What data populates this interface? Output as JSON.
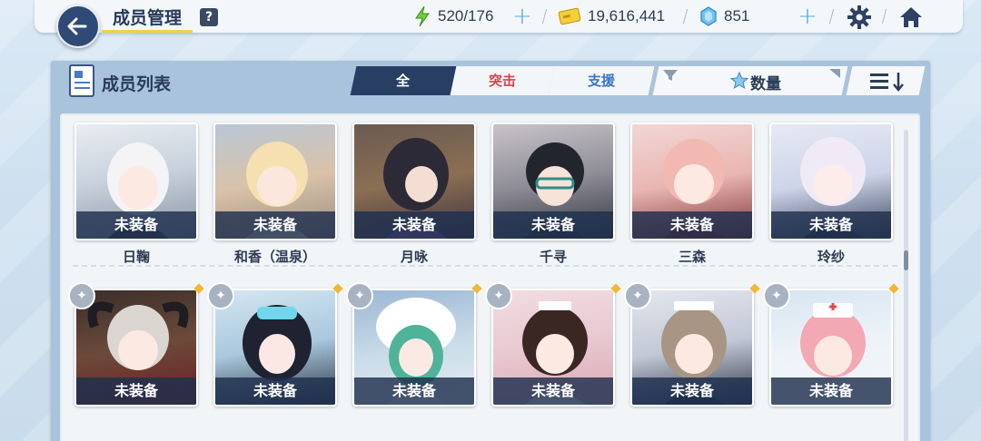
{
  "header": {
    "title": "成员管理",
    "help": "?",
    "ap": "520/176",
    "credits": "19,616,441",
    "gems": "851"
  },
  "panel": {
    "title": "成员列表",
    "tabs": [
      "全",
      "突击",
      "支援"
    ],
    "sort_label": "数量"
  },
  "row1": [
    {
      "name": "日鞠",
      "equip": "未装备"
    },
    {
      "name": "和香（温泉）",
      "equip": "未装备"
    },
    {
      "name": "月咏",
      "equip": "未装备"
    },
    {
      "name": "千寻",
      "equip": "未装备"
    },
    {
      "name": "三森",
      "equip": "未装备"
    },
    {
      "name": "玲纱",
      "equip": "未装备"
    }
  ],
  "row2": [
    {
      "equip": "未装备"
    },
    {
      "equip": "未装备"
    },
    {
      "equip": "未装备"
    },
    {
      "equip": "未装备"
    },
    {
      "equip": "未装备"
    },
    {
      "equip": "未装备"
    }
  ],
  "colors": {
    "accent": "#283e63",
    "assault": "#d9424a",
    "support": "#3a74c8",
    "star": "#f0b834"
  }
}
